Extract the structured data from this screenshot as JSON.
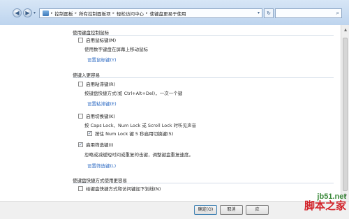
{
  "address_bar": {
    "crumbs": [
      "控制面板",
      "所有控制面板项",
      "轻松访问中心",
      "使键盘更易于使用"
    ]
  },
  "mouse_keys": {
    "section_title": "使用键盘控制鼠标",
    "checkbox_label": "启用鼠标键(M)",
    "checked": false,
    "description": "使用数字键盘在屏幕上移动鼠标",
    "link": "设置鼠标键(Y)"
  },
  "typing": {
    "section_title": "使键入更容易",
    "sticky_keys": {
      "label": "启用粘滞键(R)",
      "checked": false,
      "description": "按键盘快捷方式(如 Ctrl+Alt+Del)，一次一个键",
      "link": "设置粘滞键(E)"
    },
    "toggle_keys": {
      "label": "启用切换键(K)",
      "checked": false,
      "description": "按 Caps Lock、Num Lock 或 Scroll Lock 时听见声音",
      "sub_label": "按住 Num Lock 键 5 秒启用切换键(5)",
      "sub_checked": true
    },
    "filter_keys": {
      "label": "启用筛选键(I)",
      "checked": true,
      "description": "忽略或减缓短时间或重复的击键，调整键盘重复速度。",
      "link": "设置筛选键(L)"
    }
  },
  "shortcuts": {
    "section_title": "使键盘快捷方式使用更容易",
    "label": "给键盘快捷方式和访问键加下划线(N)",
    "checked": false
  },
  "buttons": {
    "ok": "确定(O)",
    "cancel": "取消",
    "apply": "应"
  },
  "watermark": {
    "url": "jb51.net",
    "name": "脚本之家"
  },
  "colors": {
    "link": "#2f6cc4",
    "watermark_url": "#3b8a3b",
    "watermark_name": "#d2232a"
  },
  "icons": [
    "back-arrow-icon",
    "forward-arrow-icon",
    "control-panel-icon",
    "refresh-icon",
    "search-icon",
    "checkmark-icon"
  ]
}
